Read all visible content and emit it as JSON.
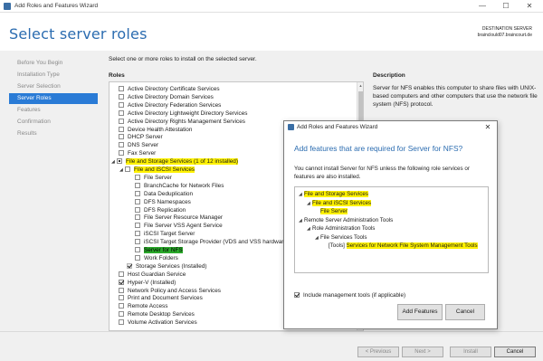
{
  "window": {
    "title": "Add Roles and Features Wizard",
    "minimize_glyph": "—",
    "maximize_glyph": "☐",
    "close_glyph": "✕"
  },
  "header": {
    "page_title": "Select server roles",
    "destination_label": "DESTINATION SERVER",
    "destination_value": "brainclould07.braincourt.de"
  },
  "nav": {
    "items": [
      {
        "label": "Before You Begin",
        "active": false
      },
      {
        "label": "Installation Type",
        "active": false
      },
      {
        "label": "Server Selection",
        "active": false
      },
      {
        "label": "Server Roles",
        "active": true
      },
      {
        "label": "Features",
        "active": false
      },
      {
        "label": "Confirmation",
        "active": false
      },
      {
        "label": "Results",
        "active": false
      }
    ]
  },
  "main": {
    "instruction": "Select one or more roles to install on the selected server.",
    "roles_heading": "Roles",
    "description_heading": "Description",
    "description_text": "Server for NFS enables this computer to share files with UNIX-based computers and other computers that use the network file system (NFS) protocol."
  },
  "roles": [
    {
      "label": "Active Directory Certificate Services",
      "state": "unchecked",
      "level": 0
    },
    {
      "label": "Active Directory Domain Services",
      "state": "unchecked",
      "level": 0
    },
    {
      "label": "Active Directory Federation Services",
      "state": "unchecked",
      "level": 0
    },
    {
      "label": "Active Directory Lightweight Directory Services",
      "state": "unchecked",
      "level": 0
    },
    {
      "label": "Active Directory Rights Management Services",
      "state": "unchecked",
      "level": 0
    },
    {
      "label": "Device Health Attestation",
      "state": "unchecked",
      "level": 0
    },
    {
      "label": "DHCP Server",
      "state": "unchecked",
      "level": 0
    },
    {
      "label": "DNS Server",
      "state": "unchecked",
      "level": 0
    },
    {
      "label": "Fax Server",
      "state": "unchecked",
      "level": 0
    },
    {
      "label": "File and Storage Services (1 of 12 installed)",
      "state": "partial",
      "level": 0,
      "highlight": true,
      "expander": "◢"
    },
    {
      "label": "File and iSCSI Services",
      "state": "unchecked",
      "level": 1,
      "highlight": true,
      "expander": "◢"
    },
    {
      "label": "File Server",
      "state": "unchecked",
      "level": 2
    },
    {
      "label": "BranchCache for Network Files",
      "state": "unchecked",
      "level": 2
    },
    {
      "label": "Data Deduplication",
      "state": "unchecked",
      "level": 2
    },
    {
      "label": "DFS Namespaces",
      "state": "unchecked",
      "level": 2
    },
    {
      "label": "DFS Replication",
      "state": "unchecked",
      "level": 2
    },
    {
      "label": "File Server Resource Manager",
      "state": "unchecked",
      "level": 2
    },
    {
      "label": "File Server VSS Agent Service",
      "state": "unchecked",
      "level": 2
    },
    {
      "label": "iSCSI Target Server",
      "state": "unchecked",
      "level": 2
    },
    {
      "label": "iSCSI Target Storage Provider (VDS and VSS hardware providers)",
      "state": "unchecked",
      "level": 2
    },
    {
      "label": "Server for NFS",
      "state": "unchecked",
      "level": 2,
      "highlight_green": true
    },
    {
      "label": "Work Folders",
      "state": "unchecked",
      "level": 2
    },
    {
      "label": "Storage Services (Installed)",
      "state": "checked-disabled",
      "level": 1
    },
    {
      "label": "Host Guardian Service",
      "state": "unchecked",
      "level": 0
    },
    {
      "label": "Hyper-V (Installed)",
      "state": "checked",
      "level": 0
    },
    {
      "label": "Network Policy and Access Services",
      "state": "unchecked",
      "level": 0
    },
    {
      "label": "Print and Document Services",
      "state": "unchecked",
      "level": 0
    },
    {
      "label": "Remote Access",
      "state": "unchecked",
      "level": 0
    },
    {
      "label": "Remote Desktop Services",
      "state": "unchecked",
      "level": 0
    },
    {
      "label": "Volume Activation Services",
      "state": "unchecked",
      "level": 0
    }
  ],
  "footer": {
    "previous": "< Previous",
    "next": "Next >",
    "install": "Install",
    "cancel": "Cancel"
  },
  "dialog": {
    "title": "Add Roles and Features Wizard",
    "close_glyph": "✕",
    "heading": "Add features that are required for Server for NFS?",
    "text": "You cannot install Server for NFS unless the following role services or features are also installed.",
    "features": [
      {
        "label": "File and Storage Services",
        "level": 0,
        "expander": "◢",
        "highlight": true
      },
      {
        "label": "File and iSCSI Services",
        "level": 1,
        "expander": "◢",
        "highlight": true
      },
      {
        "label": "File Server",
        "level": 2,
        "expander": "",
        "highlight": true
      },
      {
        "label": "Remote Server Administration Tools",
        "level": 0,
        "expander": "◢",
        "highlight": false
      },
      {
        "label": "Role Administration Tools",
        "level": 1,
        "expander": "◢",
        "highlight": false
      },
      {
        "label": "File Services Tools",
        "level": 2,
        "expander": "◢",
        "highlight": false
      },
      {
        "label": "Services for Network File System Management Tools",
        "prefix": "[Tools] ",
        "level": 3,
        "expander": "",
        "highlight": true
      }
    ],
    "include_tools_label": "Include management tools (if applicable)",
    "include_tools_checked": true,
    "add_features": "Add Features",
    "cancel": "Cancel"
  },
  "colors": {
    "accent": "#2a7bd6",
    "title_blue": "#2b6cb0",
    "highlight_yellow": "#fff200",
    "highlight_green": "#2aa82a"
  }
}
